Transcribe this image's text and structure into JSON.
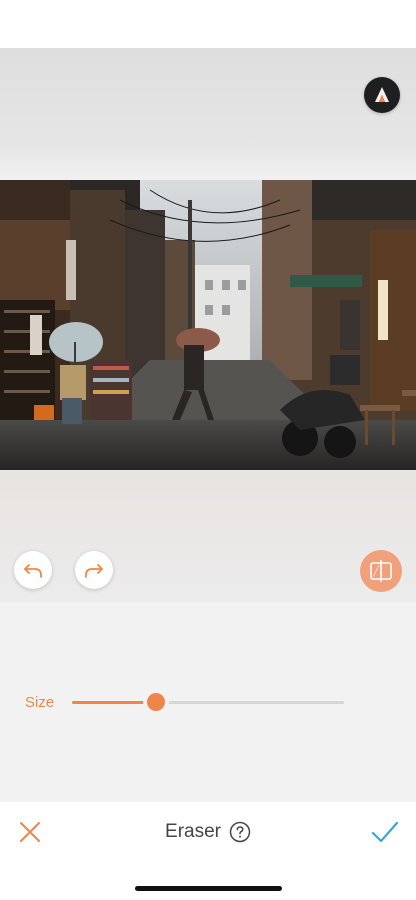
{
  "canvas": {
    "logo_icon": "airbrush-logo-icon",
    "undo_icon": "undo-arrow-icon",
    "redo_icon": "redo-arrow-icon",
    "compare_icon": "compare-before-after-icon"
  },
  "controls": {
    "size_label": "Size",
    "size_value": 0.31
  },
  "toolbar": {
    "title": "Eraser",
    "help_icon": "question-circle-icon",
    "cancel_icon": "close-x-icon",
    "confirm_icon": "checkmark-icon"
  },
  "colors": {
    "accent": "#f0854c",
    "confirm": "#3aa6d6",
    "compare_button": "#f0a07a",
    "panel_background": "#f2f2f2"
  }
}
